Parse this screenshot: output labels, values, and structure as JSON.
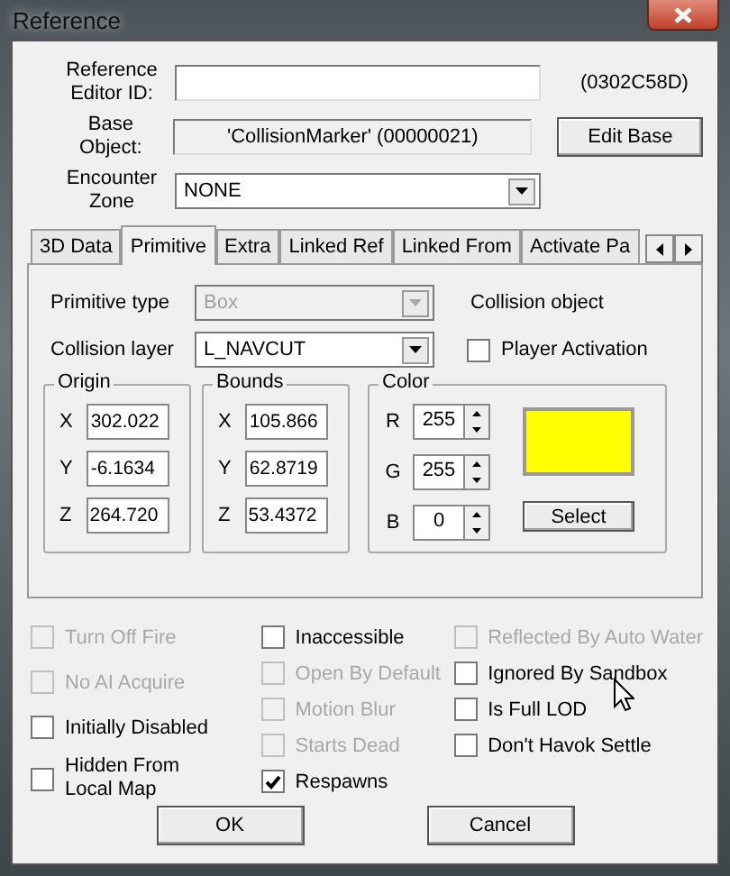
{
  "window": {
    "title": "Reference"
  },
  "header": {
    "editor_id_label": "Reference Editor ID:",
    "form_id": "(0302C58D)",
    "base_label": "Base Object:",
    "base_value": "'CollisionMarker' (00000021)",
    "edit_base_button": "Edit Base",
    "zone_label": "Encounter Zone",
    "zone_value": "NONE"
  },
  "tabs": [
    {
      "label": "3D Data",
      "selected": false
    },
    {
      "label": "Primitive",
      "selected": true
    },
    {
      "label": "Extra",
      "selected": false
    },
    {
      "label": "Linked Ref",
      "selected": false
    },
    {
      "label": "Linked From",
      "selected": false
    },
    {
      "label": "Activate Pa",
      "selected": false
    }
  ],
  "primitive": {
    "type_label": "Primitive type",
    "type_value": "Box",
    "type_disabled": true,
    "layer_label": "Collision layer",
    "layer_value": "L_NAVCUT",
    "collision_object_label": "Collision object",
    "player_activation": {
      "label": "Player Activation",
      "checked": false
    },
    "origin": {
      "title": "Origin",
      "fields": [
        {
          "axis": "X",
          "value": "302.022"
        },
        {
          "axis": "Y",
          "value": "-6.1634"
        },
        {
          "axis": "Z",
          "value": "264.720"
        }
      ]
    },
    "bounds": {
      "title": "Bounds",
      "fields": [
        {
          "axis": "X",
          "value": "105.866"
        },
        {
          "axis": "Y",
          "value": "62.8719"
        },
        {
          "axis": "Z",
          "value": "53.4372"
        }
      ]
    },
    "color": {
      "title": "Color",
      "channels": [
        {
          "label": "R",
          "value": "255"
        },
        {
          "label": "G",
          "value": "255"
        },
        {
          "label": "B",
          "value": "0"
        }
      ],
      "select_button": "Select"
    }
  },
  "flags": [
    [
      {
        "label": "Turn Off Fire",
        "checked": false,
        "disabled": true
      },
      {
        "label": "No AI Acquire",
        "checked": false,
        "disabled": true
      },
      {
        "label": "Initially Disabled",
        "checked": false,
        "disabled": false
      },
      {
        "label": "Hidden From Local Map",
        "checked": false,
        "disabled": false
      }
    ],
    [
      {
        "label": "Inaccessible",
        "checked": false,
        "disabled": false
      },
      {
        "label": "Open By Default",
        "checked": false,
        "disabled": true
      },
      {
        "label": "Motion Blur",
        "checked": false,
        "disabled": true
      },
      {
        "label": "Starts Dead",
        "checked": false,
        "disabled": true
      },
      {
        "label": "Respawns",
        "checked": true,
        "disabled": false
      }
    ],
    [
      {
        "label": "Reflected By Auto Water",
        "checked": false,
        "disabled": true
      },
      {
        "label": "Ignored By Sandbox",
        "checked": false,
        "disabled": false
      },
      {
        "label": "Is Full LOD",
        "checked": false,
        "disabled": false
      },
      {
        "label": "Don't Havok Settle",
        "checked": false,
        "disabled": false
      }
    ]
  ],
  "buttons": [
    "OK",
    "Cancel"
  ]
}
